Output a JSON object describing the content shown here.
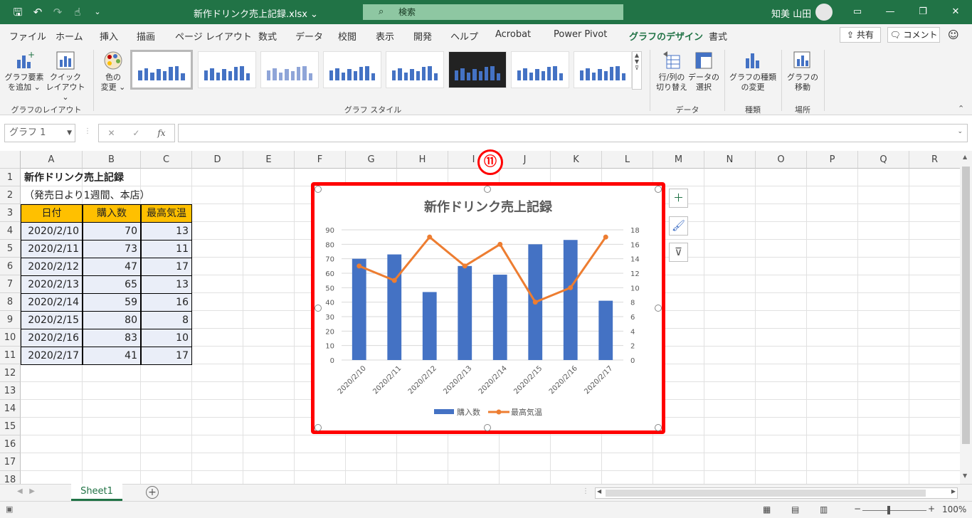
{
  "titlebar": {
    "doc_title": "新作ドリンク売上記録.xlsx ⌄",
    "search_label": "検索",
    "user_name": "知美 山田"
  },
  "tabs": [
    "ファイル",
    "ホーム",
    "挿入",
    "描画",
    "ページ レイアウト",
    "数式",
    "データ",
    "校閲",
    "表示",
    "開発",
    "ヘルプ",
    "Acrobat",
    "Power Pivot",
    "グラフのデザイン",
    "書式"
  ],
  "active_tab": "グラフのデザイン",
  "share_label": "共有",
  "comment_label": "コメント",
  "ribbon": {
    "add_element": [
      "グラフ要素",
      "を追加 ⌄"
    ],
    "quick_layout": [
      "クイック",
      "レイアウト ⌄"
    ],
    "group_layout": "グラフのレイアウト",
    "change_color": [
      "色の",
      "変更 ⌄"
    ],
    "group_styles": "グラフ スタイル",
    "switch_rowcol": [
      "行/列の",
      "切り替え"
    ],
    "select_data": [
      "データの",
      "選択"
    ],
    "group_data": "データ",
    "change_type": [
      "グラフの種類",
      "の変更"
    ],
    "group_type": "種類",
    "move_chart": [
      "グラフの",
      "移動"
    ],
    "group_location": "場所"
  },
  "namebox": "グラフ 1",
  "fx_label": "fx",
  "columns": [
    "A",
    "B",
    "C",
    "D",
    "E",
    "F",
    "G",
    "H",
    "I",
    "J",
    "K",
    "L",
    "M",
    "N",
    "O",
    "P",
    "Q",
    "R"
  ],
  "rows": [
    "1",
    "2",
    "3",
    "4",
    "5",
    "6",
    "7",
    "8",
    "9",
    "10",
    "11",
    "12",
    "13",
    "14",
    "15",
    "16",
    "17",
    "18"
  ],
  "sheet": {
    "title": "新作ドリンク売上記録",
    "subtitle": "（発売日より1週間、本店）",
    "headers": [
      "日付",
      "購入数",
      "最高気温"
    ],
    "records": [
      [
        "2020/2/10",
        "70",
        "13"
      ],
      [
        "2020/2/11",
        "73",
        "11"
      ],
      [
        "2020/2/12",
        "47",
        "17"
      ],
      [
        "2020/2/13",
        "65",
        "13"
      ],
      [
        "2020/2/14",
        "59",
        "16"
      ],
      [
        "2020/2/15",
        "80",
        "8"
      ],
      [
        "2020/2/16",
        "83",
        "10"
      ],
      [
        "2020/2/17",
        "41",
        "17"
      ]
    ]
  },
  "badge": "⑪",
  "sheet_tab": "Sheet1",
  "zoom_label": "100%",
  "colors": {
    "excel_green": "#217346",
    "bar": "#4472c4",
    "line": "#ed7d31",
    "highlight": "#ff0000",
    "header_fill": "#ffc000"
  },
  "chart_data": {
    "type": "bar",
    "title": "新作ドリンク売上記録",
    "categories": [
      "2020/2/10",
      "2020/2/11",
      "2020/2/12",
      "2020/2/13",
      "2020/2/14",
      "2020/2/15",
      "2020/2/16",
      "2020/2/17"
    ],
    "series": [
      {
        "name": "購入数",
        "type": "bar",
        "axis": "left",
        "values": [
          70,
          73,
          47,
          65,
          59,
          80,
          83,
          41
        ]
      },
      {
        "name": "最高気温",
        "type": "line",
        "axis": "right",
        "values": [
          13,
          11,
          17,
          13,
          16,
          8,
          10,
          17
        ]
      }
    ],
    "ylim_left": [
      0,
      90
    ],
    "yticks_left": [
      "0",
      "10",
      "20",
      "30",
      "40",
      "50",
      "60",
      "70",
      "80",
      "90"
    ],
    "ylim_right": [
      0,
      18
    ],
    "yticks_right": [
      "0",
      "2",
      "4",
      "6",
      "8",
      "10",
      "12",
      "14",
      "16",
      "18"
    ],
    "grid": true,
    "legend": "bottom"
  }
}
